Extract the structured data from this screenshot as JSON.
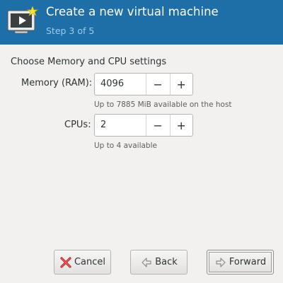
{
  "header": {
    "title": "Create a new virtual machine",
    "subtitle": "Step 3 of 5",
    "icon": "vm-monitor-icon",
    "background": "#1e6fa8"
  },
  "section_label": "Choose Memory and CPU settings",
  "memory": {
    "label": "Memory (RAM):",
    "value": "4096",
    "decrement_label": "−",
    "increment_label": "+",
    "hint": "Up to 7885 MiB available on the host"
  },
  "cpus": {
    "label": "CPUs:",
    "value": "2",
    "decrement_label": "−",
    "increment_label": "+",
    "hint": "Up to 4 available"
  },
  "buttons": {
    "cancel_label": "Cancel",
    "cancel_icon": "red-x-icon",
    "back_label": "Back",
    "back_icon": "arrow-left-icon",
    "forward_label": "Forward",
    "forward_icon": "arrow-right-icon"
  }
}
